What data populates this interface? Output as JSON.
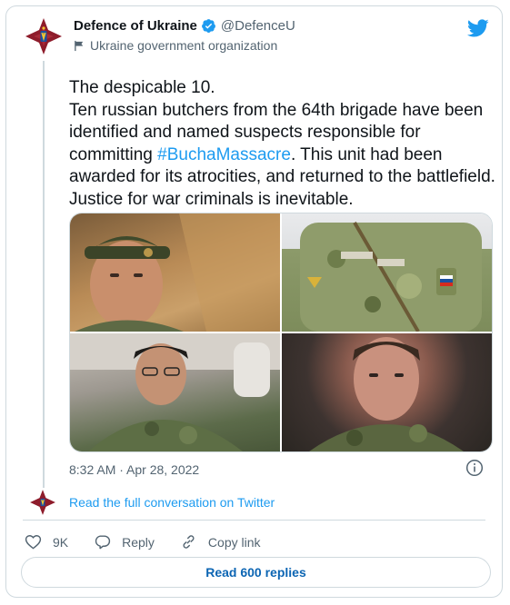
{
  "account": {
    "name": "Defence of Ukraine",
    "handle": "@DefenceU",
    "label": "Ukraine government organization"
  },
  "tweet": {
    "line1": "The despicable 10.",
    "body_before": "Ten russian butchers from the 64th brigade have been identified and named suspects responsible for committing ",
    "hashtag": "#BuchaMassacre",
    "body_after": ". This unit had been awarded for its atrocities, and returned to the battlefield. Justice for war criminals is inevitable."
  },
  "timestamp": "8:32 AM · Apr 28, 2022",
  "conversation_link": "Read the full conversation on Twitter",
  "actions": {
    "likes": "9K",
    "reply": "Reply",
    "copy": "Copy link"
  },
  "read_replies": "Read 600 replies",
  "colors": {
    "link": "#1d9bf0",
    "verified": "#1d9bf0",
    "emblem": "#8e1c2b"
  },
  "icons": [
    "verified-badge-icon",
    "flag-icon",
    "twitter-bird-icon",
    "info-icon",
    "heart-icon",
    "reply-icon",
    "link-icon"
  ]
}
